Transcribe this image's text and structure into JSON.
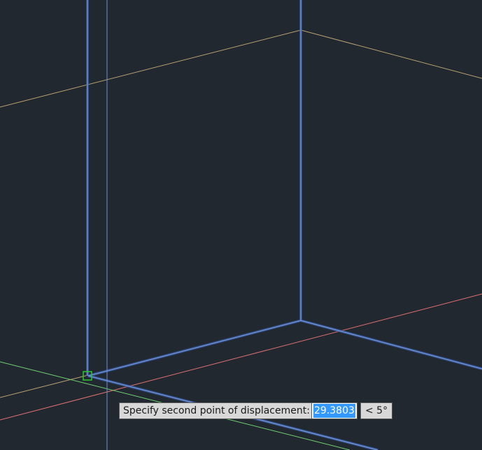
{
  "prompt": {
    "text": "Specify second point of displacement:",
    "distance_value": "29.3803",
    "angle_value": "< 5°"
  },
  "colors": {
    "background": "#212830",
    "edge_blue": "#6a8fd8",
    "edge_blue_glow": "#3a5a9c",
    "guide_tan": "#b8a070",
    "axis_red": "#e07070",
    "axis_green": "#70d070",
    "osnap_marker": "#2cc82c"
  }
}
